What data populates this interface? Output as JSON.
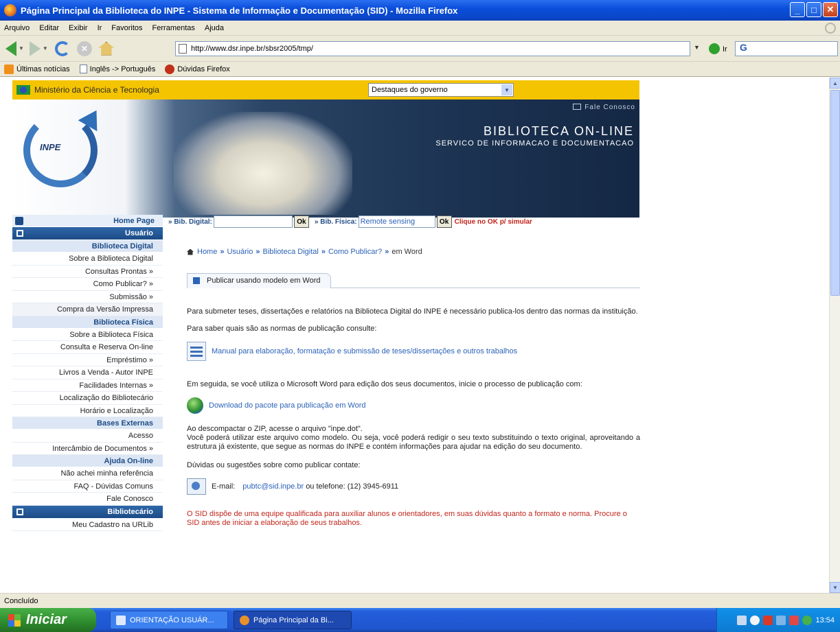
{
  "window": {
    "title": "Página Principal da Biblioteca do INPE - Sistema de Informação e Documentação (SID) - Mozilla Firefox"
  },
  "menubar": [
    "Arquivo",
    "Editar",
    "Exibir",
    "Ir",
    "Favoritos",
    "Ferramentas",
    "Ajuda"
  ],
  "navbar": {
    "url": "http://www.dsr.inpe.br/sbsr2005/tmp/",
    "go_label": "Ir"
  },
  "bookmarks": [
    "Últimas notícias",
    "Inglês -> Português",
    "Dúvidas Firefox"
  ],
  "gov": {
    "ministry": "Ministério da Ciência e Tecnologia",
    "select_value": "Destaques do governo"
  },
  "banner": {
    "logo_text": "INPE",
    "fale": "Fale Conosco",
    "title": "BIBLIOTECA ON-LINE",
    "subtitle": "SERVICO DE INFORMACAO E DOCUMENTACAO"
  },
  "search": {
    "digital_label": "» Bib. Digital:",
    "digital_value": "",
    "ok": "Ok",
    "fisica_label": "» Bib. Física:",
    "fisica_value": "Remote sensing",
    "hint": "Clique no OK p/ simular"
  },
  "sidebar": {
    "home": "Home Page",
    "usuario": "Usuário",
    "bib_digital": "Biblioteca Digital",
    "bib_digital_items": [
      "Sobre a Biblioteca Digital",
      "Consultas Prontas »",
      "Como Publicar? »",
      "Submissão »"
    ],
    "compra": "Compra da Versão Impressa",
    "bib_fisica": "Biblioteca Física",
    "bib_fisica_items": [
      "Sobre a Biblioteca Física",
      "Consulta e Reserva On-line",
      "Empréstimo »",
      "Livros a Venda - Autor INPE",
      "Facilidades Internas »",
      "Localização do Bibliotecário",
      "Horário e Localização"
    ],
    "bases": "Bases Externas",
    "bases_items": [
      "Acesso",
      "Intercâmbio de Documentos »"
    ],
    "ajuda": "Ajuda On-line",
    "ajuda_items": [
      "Não achei minha referência",
      "FAQ - Dúvidas Comuns",
      "Fale Conosco"
    ],
    "bibliotecario": "Bibliotecário",
    "bibliotecario_items": [
      "Meu Cadastro na URLib"
    ]
  },
  "main": {
    "breadcrumb": {
      "home": "Home",
      "usuario": "Usuário",
      "bib_digital": "Biblioteca Digital",
      "como_publicar": "Como Publicar?",
      "current": "em Word",
      "sep": "»"
    },
    "tab": "Publicar usando modelo em Word",
    "p1": "Para submeter teses, dissertações e relatórios na Biblioteca Digital do INPE é necessário publica-los dentro das normas da instituição.",
    "p2": "Para saber quais são as normas de publicação consulte:",
    "manual_link": "Manual para elaboração, formatação e submissão de teses/dissertações e outros trabalhos",
    "p3": "Em seguida, se você utiliza o Microsoft Word para edição dos seus documentos, inicie o processo de publicação com:",
    "download_link": "Download do pacote para publicação em Word",
    "p4": "Ao descompactar o ZIP, acesse o arquivo \"inpe.dot\".",
    "p5": "Você poderá utilizar este arquivo como modelo. Ou seja, você poderá redigir o seu texto substituindo o texto original, aproveitando a estrutura já existente, que segue as normas do INPE e contém informações para ajudar na edição do seu documento.",
    "p6": "Dúvidas ou sugestões sobre como publicar contate:",
    "email_label": "E-mail:",
    "email": "pubtc@sid.inpe.br",
    "phone_text": "ou telefone: (12) 3945-6911",
    "red_note": "O SID dispõe de uma equipe qualificada para auxiliar alunos e orientadores, em suas dúvidas quanto a formato e norma. Procure o SID antes de iniciar a elaboração de seus trabalhos."
  },
  "status": "Concluído",
  "taskbar": {
    "start": "Iniciar",
    "tasks": [
      "ORIENTAÇÃO USUÁR...",
      "Página Principal da Bi..."
    ],
    "clock": "13:54"
  }
}
